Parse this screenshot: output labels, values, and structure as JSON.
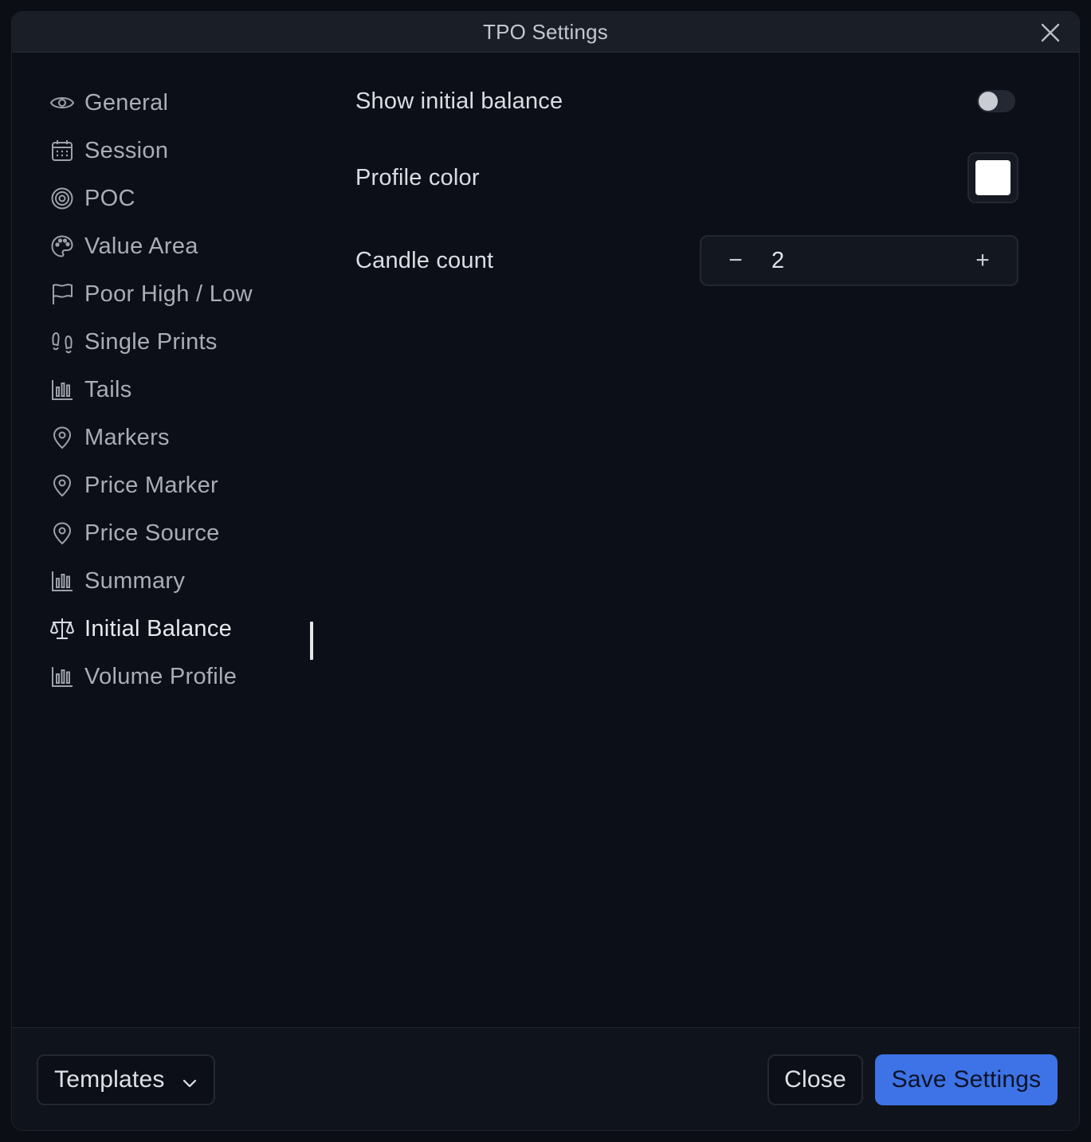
{
  "dialog": {
    "title": "TPO Settings"
  },
  "sidebar": {
    "items": [
      {
        "label": "General",
        "icon": "eye-icon"
      },
      {
        "label": "Session",
        "icon": "calendar-icon"
      },
      {
        "label": "POC",
        "icon": "target-icon"
      },
      {
        "label": "Value Area",
        "icon": "palette-icon"
      },
      {
        "label": "Poor High / Low",
        "icon": "flag-icon"
      },
      {
        "label": "Single Prints",
        "icon": "footprints-icon"
      },
      {
        "label": "Tails",
        "icon": "bar-chart-icon"
      },
      {
        "label": "Markers",
        "icon": "map-pin-icon"
      },
      {
        "label": "Price Marker",
        "icon": "map-pin-icon"
      },
      {
        "label": "Price Source",
        "icon": "map-pin-icon"
      },
      {
        "label": "Summary",
        "icon": "bar-chart-icon"
      },
      {
        "label": "Initial Balance",
        "icon": "scale-icon"
      },
      {
        "label": "Volume Profile",
        "icon": "bar-chart-icon"
      }
    ],
    "active_item": "Initial Balance"
  },
  "settings": {
    "show_initial_balance": {
      "label": "Show initial balance",
      "enabled": false
    },
    "profile_color": {
      "label": "Profile color",
      "value": "#ffffff"
    },
    "candle_count": {
      "label": "Candle count",
      "value": "2",
      "decrement": "−",
      "increment": "+"
    }
  },
  "footer": {
    "templates_label": "Templates",
    "close_label": "Close",
    "save_label": "Save Settings"
  },
  "colors": {
    "accent": "#3d73e6",
    "background": "#0c0f17"
  }
}
